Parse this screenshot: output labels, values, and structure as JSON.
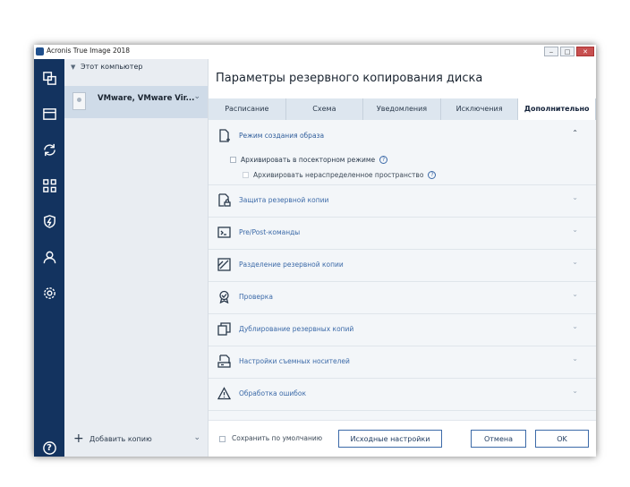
{
  "window": {
    "title": "Acronis True Image 2018",
    "controls": [
      "‒",
      "□",
      "✕"
    ]
  },
  "left_panel": {
    "header": "Этот компьютер",
    "source_name": "VMware, VMware Vir...",
    "add_copy_label": "Добавить копию"
  },
  "main": {
    "title": "Параметры резервного копирования диска",
    "tabs": [
      {
        "label": "Расписание"
      },
      {
        "label": "Схема"
      },
      {
        "label": "Уведомления"
      },
      {
        "label": "Исключения"
      },
      {
        "label": "Дополнительно"
      }
    ],
    "sections": [
      {
        "title": "Режим создания образа",
        "icon": "image-mode-icon",
        "expanded": true,
        "options": [
          {
            "label": "Архивировать в посекторном режиме",
            "checked": false
          },
          {
            "label": "Архивировать нераспределенное пространство",
            "checked": false,
            "disabled": true
          }
        ]
      },
      {
        "title": "Защита резервной копии",
        "icon": "lock-icon"
      },
      {
        "title": "Pre/Post-команды",
        "icon": "terminal-icon"
      },
      {
        "title": "Разделение резервной копии",
        "icon": "split-icon"
      },
      {
        "title": "Проверка",
        "icon": "badge-icon"
      },
      {
        "title": "Дублирование резервных копий",
        "icon": "duplicate-icon"
      },
      {
        "title": "Настройки съемных носителей",
        "icon": "removable-media-icon"
      },
      {
        "title": "Обработка ошибок",
        "icon": "warning-icon"
      }
    ]
  },
  "footer": {
    "save_default_label": "Сохранить по умолчанию",
    "reset_label": "Исходные настройки",
    "cancel_label": "Отмена",
    "ok_label": "OK"
  },
  "help_glyph": "?",
  "colors": {
    "rail": "#13335f",
    "accent": "#3c6aa8"
  }
}
